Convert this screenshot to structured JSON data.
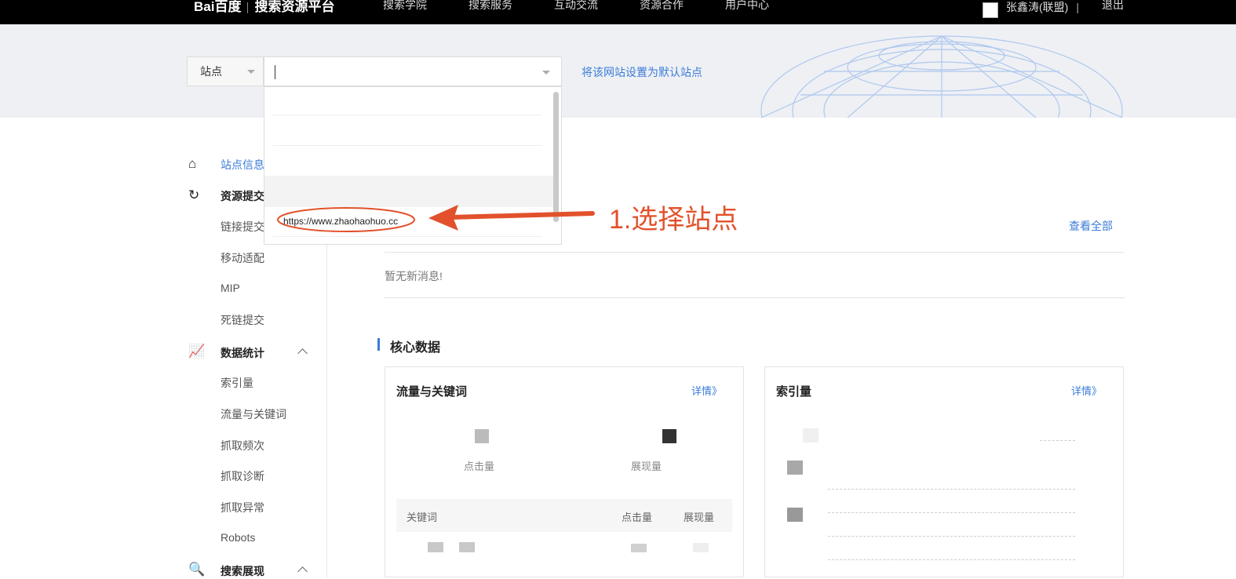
{
  "topbar": {
    "logo_text": "Bai百度",
    "platform": "搜索资源平台",
    "nav": [
      "搜索学院",
      "搜索服务",
      "互动交流",
      "资源合作",
      "用户中心"
    ],
    "username": "张鑫涛(联盟)",
    "separator": "|",
    "logout": "退出"
  },
  "site_selector": {
    "label": "站点",
    "input_value": "",
    "set_default": "将该网站设置为默认站点",
    "dropdown_option": "https://www.zhaohaohuo.cc"
  },
  "annotation": {
    "text": "1.选择站点",
    "color": "#e2512b"
  },
  "sidebar": {
    "site_info": "站点信息",
    "resource_submit": "资源提交",
    "resource_items": [
      "链接提交",
      "移动适配",
      "MIP",
      "死链提交"
    ],
    "data_stats": "数据统计",
    "data_items": [
      "索引量",
      "流量与关键词",
      "抓取频次",
      "抓取诊断",
      "抓取异常",
      "Robots"
    ],
    "search_display": "搜索展现"
  },
  "messages": {
    "view_all": "查看全部",
    "empty": "暂无新消息!"
  },
  "core_data": {
    "title": "核心数据",
    "traffic_card": {
      "title": "流量与关键词",
      "detail": "详情》",
      "clicks_label": "点击量",
      "impressions_label": "展现量",
      "table_headers": [
        "关键词",
        "点击量",
        "展现量"
      ]
    },
    "index_card": {
      "title": "索引量",
      "detail": "详情》"
    }
  },
  "colors": {
    "accent": "#3b7cd8",
    "topbar": "#000000",
    "annotation": "#e2512b"
  }
}
